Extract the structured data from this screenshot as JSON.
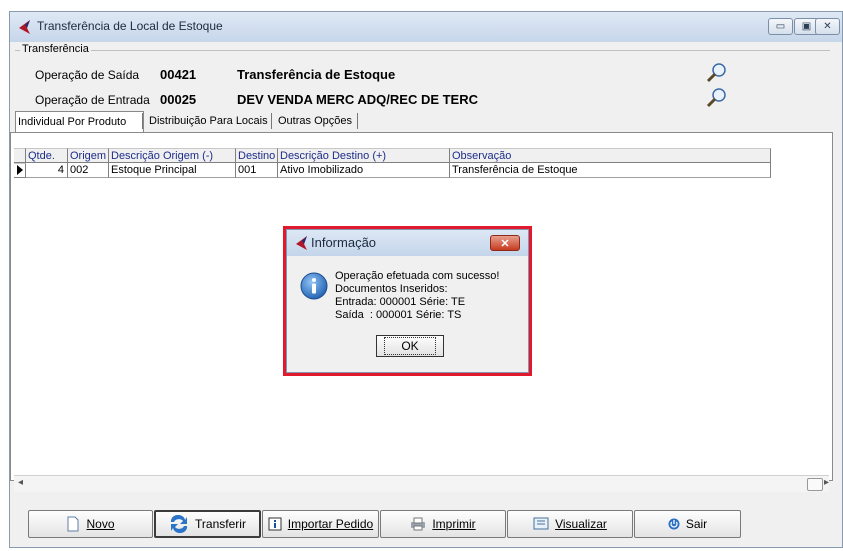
{
  "window": {
    "title": "Transferência de Local de Estoque",
    "controls": {
      "minimize": "▭",
      "maximize": "▣",
      "close": "✕"
    }
  },
  "transfer_group": {
    "label": "Transferência",
    "saida": {
      "label": "Operação de Saída",
      "code": "00421",
      "description": "Transferência de Estoque"
    },
    "entrada": {
      "label": "Operação de Entrada",
      "code": "00025",
      "description": "DEV VENDA MERC ADQ/REC DE TERC"
    }
  },
  "tabs": [
    {
      "label": "Individual Por Produto",
      "active": true
    },
    {
      "label": "Distribuição Para Locais",
      "active": false
    },
    {
      "label": "Outras Opções",
      "active": false
    }
  ],
  "grid": {
    "columns": [
      "Qtde.",
      "Origem",
      "Descrição Origem (-)",
      "Destino",
      "Descrição Destino (+)",
      "Observação"
    ],
    "rows": [
      {
        "qtde": "4",
        "origem": "002",
        "descricao_origem": "Estoque Principal",
        "destino": "001",
        "descricao_destino": "Ativo Imobilizado",
        "observacao": "Transferência de Estoque"
      }
    ]
  },
  "toolbar": {
    "novo": "Novo",
    "transferir": "Transferir",
    "importar": "Importar Pedido",
    "imprimir": "Imprimir",
    "visualizar": "Visualizar",
    "sair": "Sair"
  },
  "dialog": {
    "title": "Informação",
    "close": "✕",
    "lines": [
      "Operação efetuada com sucesso!",
      "Documentos Inseridos:",
      "Entrada: 000001 Série: TE",
      "Saída  : 000001 Série: TS"
    ],
    "ok_label": "OK"
  },
  "colors": {
    "highlight_frame": "#e0192d",
    "header_text": "#1d2d8a"
  }
}
